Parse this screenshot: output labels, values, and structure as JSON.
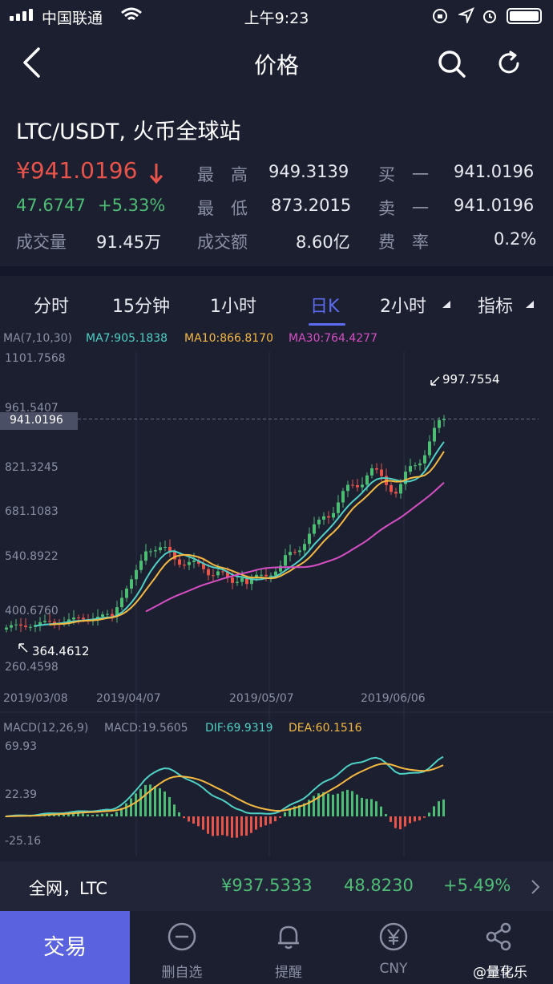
{
  "status": {
    "carrier": "中国联通",
    "time": "上午9:23"
  },
  "nav": {
    "title": "价格"
  },
  "info": {
    "pair": "LTC/USDT, 火币全球站",
    "price": "¥941.0196",
    "change": "47.6747",
    "change_pct": "+5.33%",
    "high_label": "最　高",
    "high": "949.3139",
    "low_label": "最　低",
    "low": "873.2015",
    "volume_label": "成交量",
    "volume": "91.45万",
    "amount_label": "成交额",
    "amount": "8.60亿",
    "buy1_label": "买　一",
    "buy1": "941.0196",
    "sell1_label": "卖　一",
    "sell1": "941.0196",
    "fee_label": "费　率",
    "fee": "0.2%"
  },
  "tabs": [
    "分时",
    "15分钟",
    "1小时",
    "日K",
    "2小时",
    "指标"
  ],
  "active_tab": "日K",
  "chart_data": [
    {
      "type": "candlestick",
      "legend": {
        "ma_label": "MA(7,10,30)",
        "ma7": "MA7:905.1838",
        "ma10": "MA10:866.8170",
        "ma30": "MA30:764.4277"
      },
      "y_ticks": [
        "1101.7568",
        "961.5407",
        "821.3245",
        "681.1083",
        "540.8922",
        "400.6760",
        "260.4598"
      ],
      "ylim": [
        260.4598,
        1101.7568
      ],
      "x_ticks": [
        "2019/03/08",
        "2019/04/07",
        "2019/05/07",
        "2019/06/06"
      ],
      "current_price_label": "941.0196",
      "max_annotation": "997.7554",
      "min_annotation": "364.4612",
      "series": [
        {
          "name": "MA7",
          "color": "#4fd1c5"
        },
        {
          "name": "MA10",
          "color": "#f5b942"
        },
        {
          "name": "MA30",
          "color": "#d64fc4"
        }
      ]
    },
    {
      "type": "macd",
      "legend": {
        "label": "MACD(12,26,9)",
        "macd": "MACD:19.5605",
        "dif": "DIF:69.9319",
        "dea": "DEA:60.1516"
      },
      "y_ticks": [
        "69.93",
        "22.39",
        "-25.16"
      ],
      "ylim": [
        -40,
        80
      ]
    }
  ],
  "ticker": {
    "label": "全网，LTC",
    "price": "¥937.5333",
    "change": "48.8230",
    "change_pct": "+5.49%"
  },
  "bottom": {
    "trade": "交易",
    "items": [
      "删自选",
      "提醒",
      "CNY",
      "分享"
    ]
  },
  "watermark": "@量化乐",
  "colors": {
    "up": "#4dbd74",
    "down": "#e8534a",
    "accent": "#5b6cf0"
  }
}
